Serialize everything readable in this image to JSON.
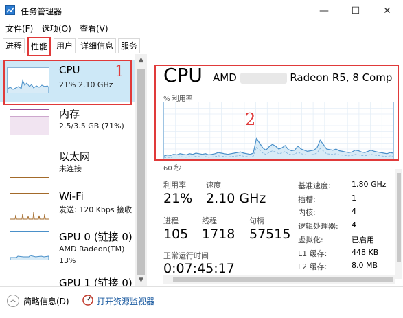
{
  "window": {
    "title": "任务管理器",
    "minimize": "—",
    "maximize": "☐",
    "close": "✕"
  },
  "menu": [
    "文件(F)",
    "选项(O)",
    "查看(V)"
  ],
  "tabs": [
    "进程",
    "性能",
    "用户",
    "详细信息",
    "服务"
  ],
  "active_tab": "性能",
  "sidebar": {
    "items": [
      {
        "name": "CPU",
        "detail": "21% 2.10 GHz"
      },
      {
        "name": "内存",
        "detail": "2.5/3.5 GB (71%)"
      },
      {
        "name": "以太网",
        "detail": "未连接"
      },
      {
        "name": "Wi-Fi",
        "detail": "发送: 120 Kbps 接收"
      },
      {
        "name": "GPU 0 (链接 0)",
        "detail": "AMD Radeon(TM)",
        "detail2": "13%"
      },
      {
        "name": "GPU 1 (链接 0)"
      }
    ]
  },
  "main": {
    "title": "CPU",
    "model_prefix": "AMD",
    "model_suffix": "Radeon R5, 8 Comp",
    "util_label": "% 利用率",
    "time_label": "60 秒",
    "stats": {
      "utilization_label": "利用率",
      "utilization": "21%",
      "speed_label": "速度",
      "speed": "2.10 GHz",
      "processes_label": "进程",
      "processes": "105",
      "threads_label": "线程",
      "threads": "1718",
      "handles_label": "句柄",
      "handles": "57515",
      "uptime_label": "正常运行时间",
      "uptime": "0:07:45:17"
    },
    "details": [
      {
        "label": "基准速度:",
        "value": "1.80 GHz"
      },
      {
        "label": "插槽:",
        "value": "1"
      },
      {
        "label": "内核:",
        "value": "4"
      },
      {
        "label": "逻辑处理器:",
        "value": "4"
      },
      {
        "label": "虚拟化:",
        "value": "已启用"
      },
      {
        "label": "L1 缓存:",
        "value": "448 KB"
      },
      {
        "label": "L2 缓存:",
        "value": "8.0 MB"
      }
    ],
    "cpu_history_percent": [
      8,
      10,
      9,
      11,
      10,
      12,
      11,
      10,
      12,
      11,
      13,
      12,
      11,
      12,
      10,
      11,
      12,
      14,
      13,
      12,
      11,
      12,
      13,
      14,
      15,
      13,
      12,
      11,
      13,
      38,
      30,
      22,
      18,
      24,
      28,
      25,
      20,
      22,
      26,
      19,
      17,
      18,
      25,
      20,
      18,
      16,
      17,
      18,
      22,
      35,
      28,
      20,
      19,
      18,
      20,
      17,
      16,
      15,
      14,
      15,
      18,
      17,
      15,
      14,
      16,
      18,
      16,
      15,
      14,
      13,
      12,
      14,
      13
    ]
  },
  "annotations": {
    "one": "1",
    "two": "2"
  },
  "bottom": {
    "collapse": "简略信息(D)",
    "monitor": "打开资源监视器"
  },
  "colors": {
    "accent": "#4a90c9",
    "annotation": "#e03a3a",
    "selected": "#cde8f7"
  }
}
